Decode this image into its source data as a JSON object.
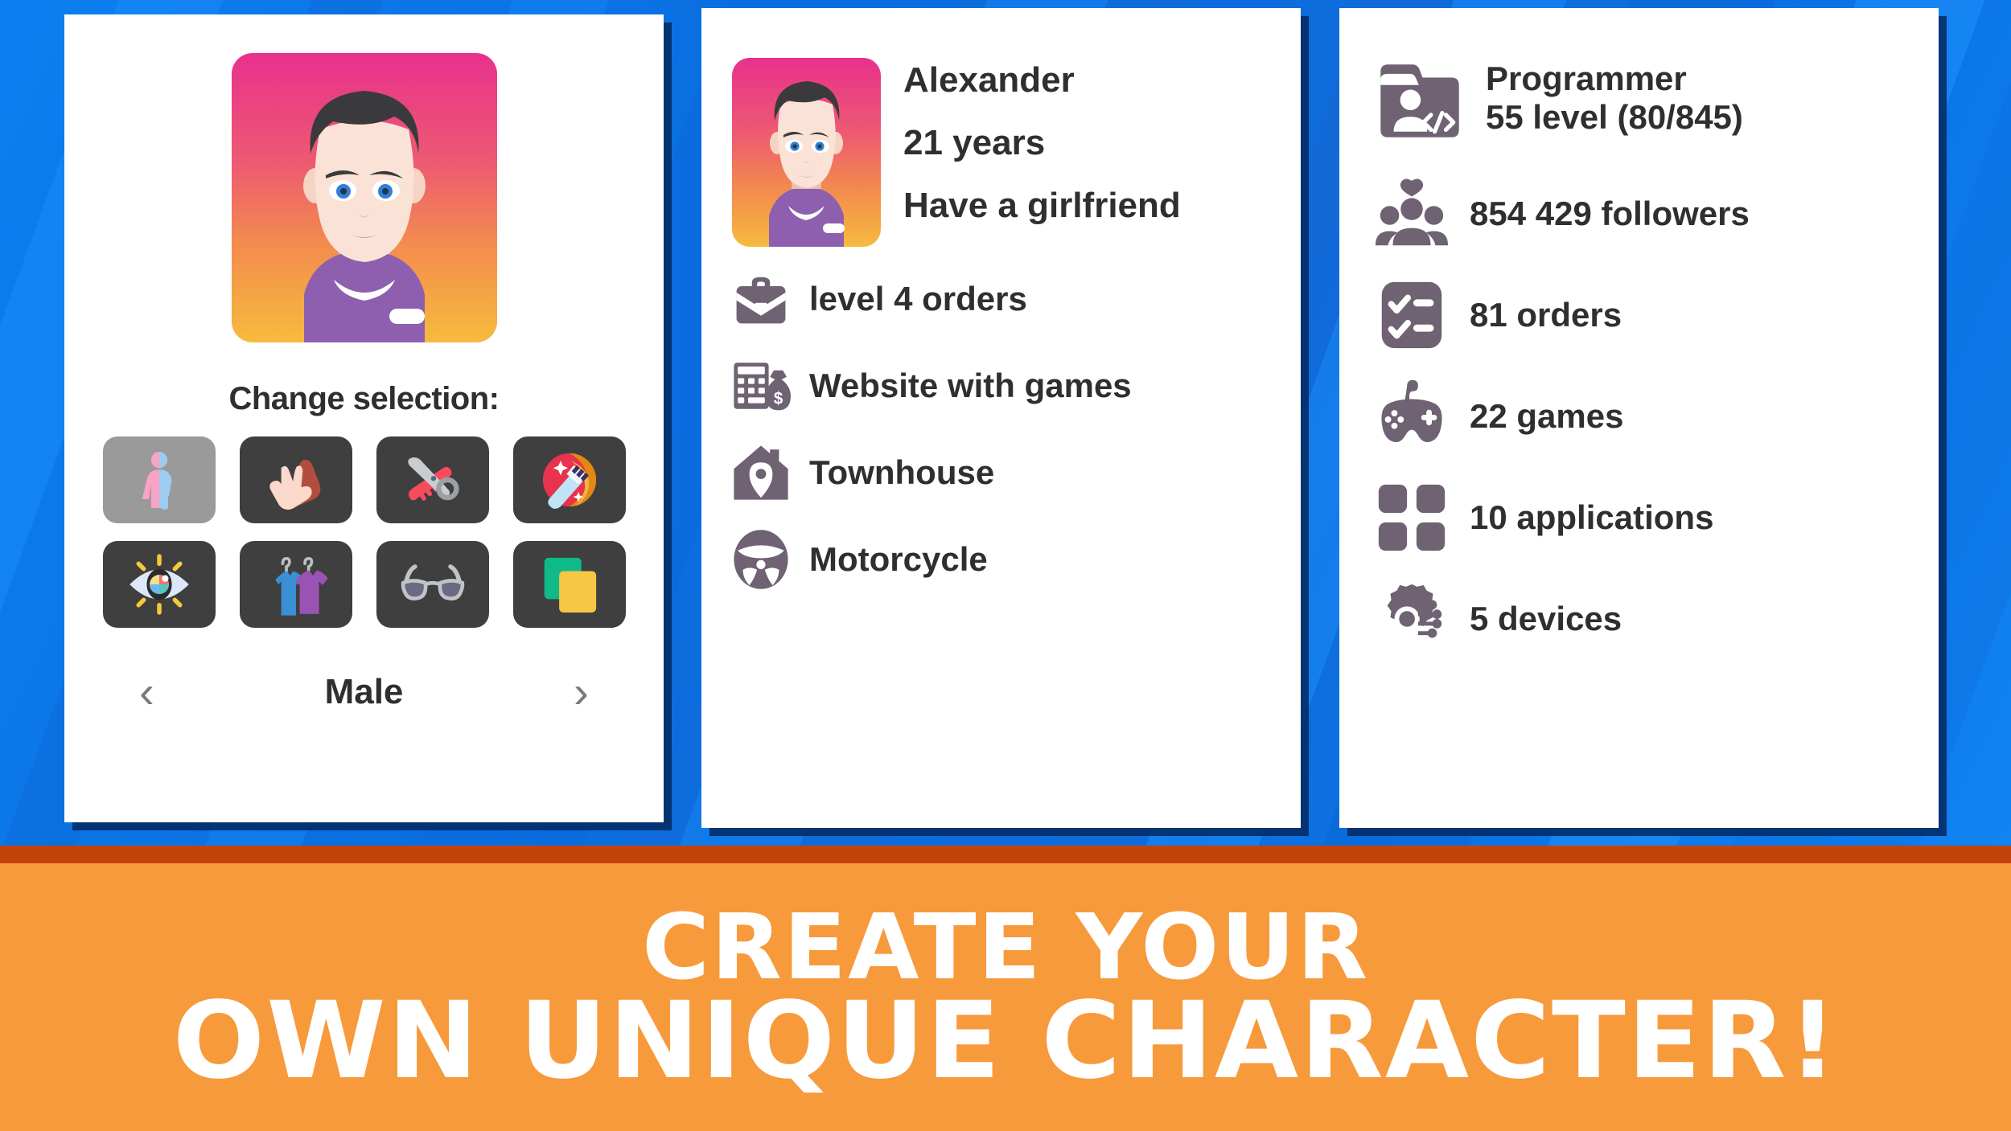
{
  "background": {
    "color_primary": "#0d7ff0",
    "color_secondary": "#0a6fe0",
    "shadow_color": "#03285f"
  },
  "left_card": {
    "avatar": {
      "name": "character-avatar-large",
      "gradient_top": "#e8318d",
      "gradient_bottom": "#f6bb3d"
    },
    "change_label": "Change selection:",
    "icons": [
      {
        "name": "gender-icon",
        "label": "Gender",
        "selected": true
      },
      {
        "name": "skin-tone-icon",
        "label": "Skin tone",
        "selected": false
      },
      {
        "name": "haircut-icon",
        "label": "Haircut",
        "selected": false
      },
      {
        "name": "hair-color-icon",
        "label": "Hair color",
        "selected": false
      },
      {
        "name": "eye-color-icon",
        "label": "Eye color",
        "selected": false
      },
      {
        "name": "clothes-icon",
        "label": "Clothes",
        "selected": false
      },
      {
        "name": "glasses-icon",
        "label": "Glasses",
        "selected": false
      },
      {
        "name": "background-icon",
        "label": "Background",
        "selected": false
      }
    ],
    "prev_arrow": "‹",
    "next_arrow": "›",
    "gender_value": "Male"
  },
  "middle_card": {
    "avatar": {
      "name": "character-avatar-small",
      "gradient_top": "#e8318d",
      "gradient_bottom": "#f6bb3d"
    },
    "header_lines": [
      "Alexander",
      "21 years",
      "Have a girlfriend"
    ],
    "rows": [
      {
        "icon": "briefcase-icon",
        "text": "level 4 orders"
      },
      {
        "icon": "money-bag-icon",
        "text": "Website with games"
      },
      {
        "icon": "house-pin-icon",
        "text": "Townhouse"
      },
      {
        "icon": "steering-wheel-icon",
        "text": "Motorcycle"
      }
    ]
  },
  "right_card": {
    "rows": [
      {
        "icon": "programmer-folder-icon",
        "text": "Programmer",
        "text2": "55 level (80/845)"
      },
      {
        "icon": "followers-icon",
        "text": "854 429 followers"
      },
      {
        "icon": "checklist-icon",
        "text": "81 orders"
      },
      {
        "icon": "gamepad-icon",
        "text": "22 games"
      },
      {
        "icon": "apps-grid-icon",
        "text": "10 applications"
      },
      {
        "icon": "devices-gear-icon",
        "text": "5 devices"
      }
    ]
  },
  "banner": {
    "line1": "Create your",
    "line2": "own unique character!",
    "bg_color": "#f79a3c",
    "rule_color": "#c4430c",
    "text_color": "#ffffff"
  }
}
